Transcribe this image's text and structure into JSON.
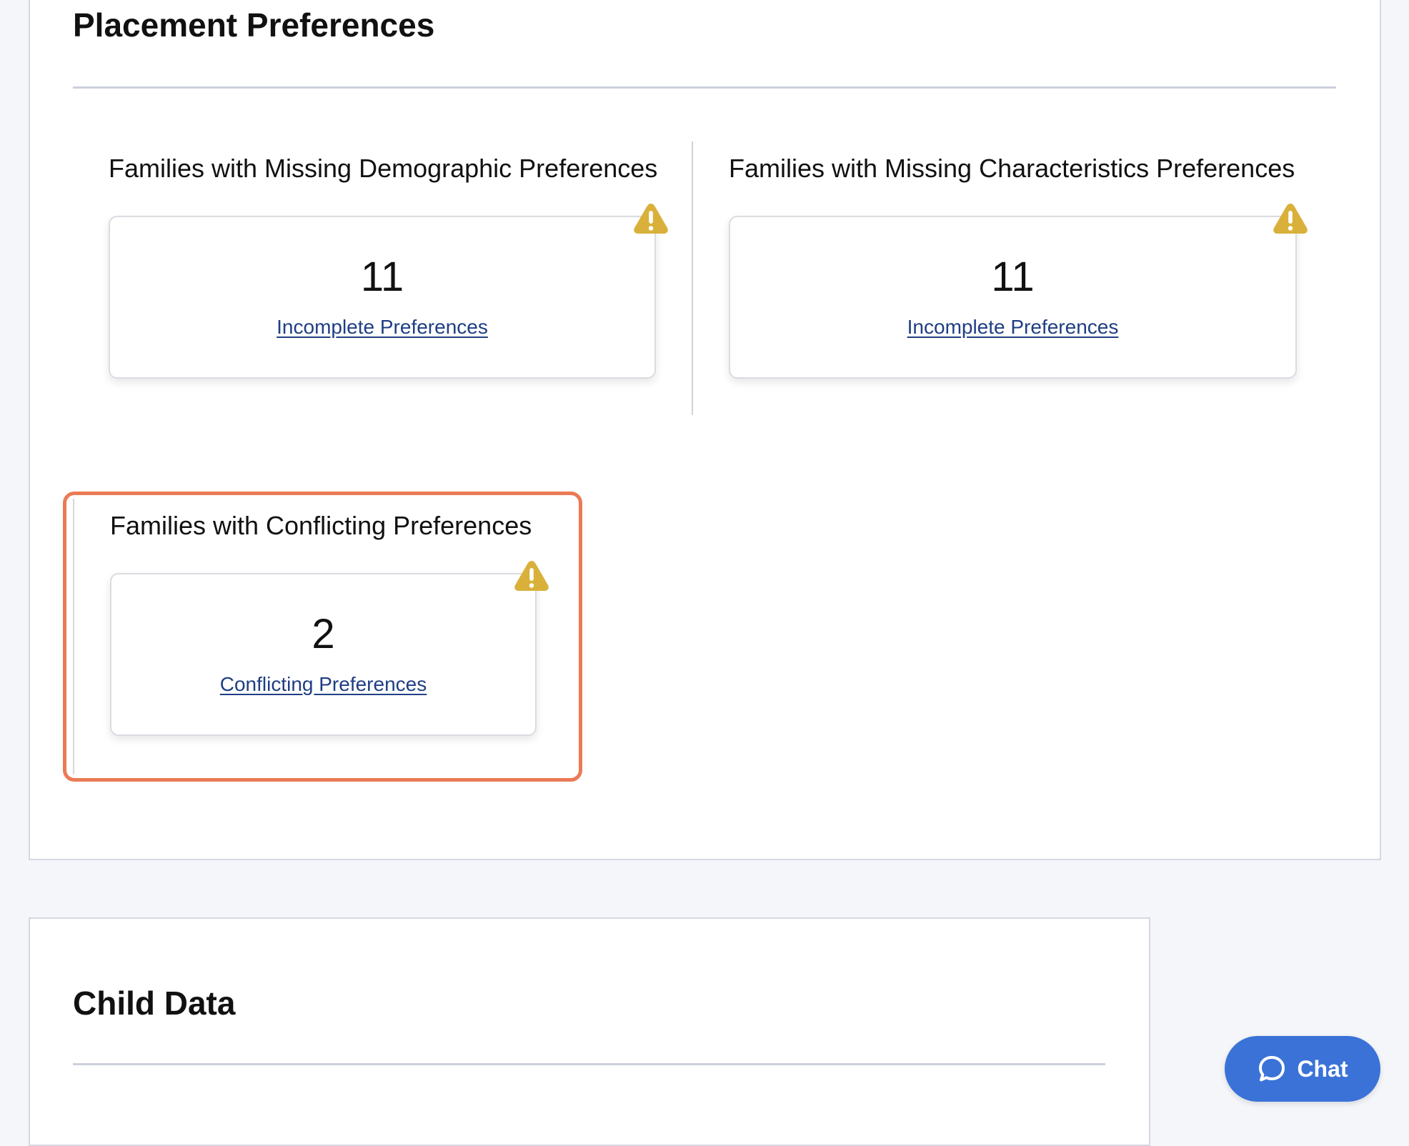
{
  "placement": {
    "title": "Placement Preferences",
    "widgets": [
      {
        "title": "Families with Missing Demographic Preferences",
        "value": "11",
        "link": "Incomplete Preferences",
        "icon": "warning-icon"
      },
      {
        "title": "Families with Missing Characteristics Preferences",
        "value": "11",
        "link": "Incomplete Preferences",
        "icon": "warning-icon"
      },
      {
        "title": "Families with Conflicting Preferences",
        "value": "2",
        "link": "Conflicting Preferences",
        "icon": "warning-icon"
      }
    ]
  },
  "child_data": {
    "title": "Child Data"
  },
  "chat": {
    "label": "Chat",
    "icon": "chat-bubble-icon"
  },
  "colors": {
    "page_background": "#f5f6fa",
    "link": "#1f3e83",
    "warning": "#d9b13a",
    "highlight": "#eb7a55",
    "chat_button": "#3a72d8"
  }
}
